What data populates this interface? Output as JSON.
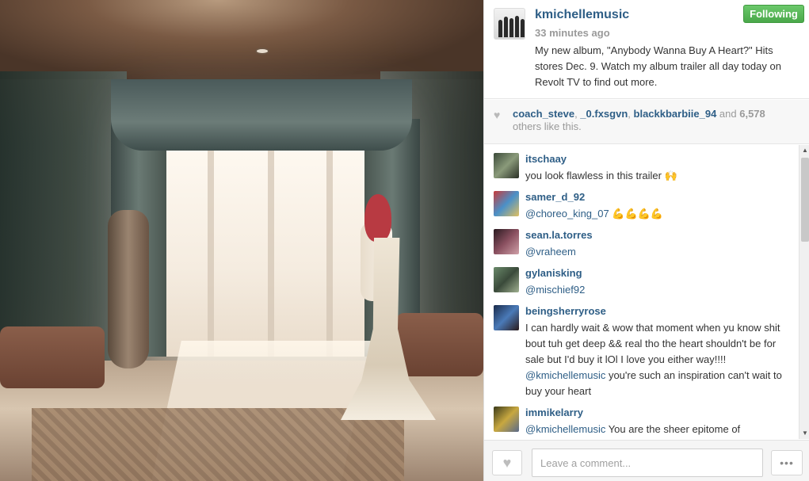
{
  "post": {
    "username": "kmichellemusic",
    "time": "33 minutes ago",
    "caption": "My new album, \"Anybody Wanna Buy A Heart?\" Hits stores Dec. 9. Watch my album trailer all day today on Revolt TV to find out more.",
    "follow_label": "Following"
  },
  "likes": {
    "user1": "coach_steve",
    "sep1": ", ",
    "user2": "_0.fxsgvn",
    "sep2": ", ",
    "user3": "blackkbarbiie_94",
    "and": " and ",
    "count": "6,578",
    "tail": "others like this."
  },
  "comments": [
    {
      "user": "itschaay",
      "text": "you look flawless in this trailer 🙌"
    },
    {
      "user": "samer_d_92",
      "mention": "@choreo_king_07",
      "text": " 💪💪💪💪"
    },
    {
      "user": "sean.la.torres",
      "mention": "@vraheem",
      "text": ""
    },
    {
      "user": "gylanisking",
      "mention": "@mischief92",
      "text": ""
    },
    {
      "user": "beingsherryrose",
      "text": "I can hardly wait & wow that moment when yu know shit bout tuh get deep && real tho the heart shouldn't be for sale but I'd buy it lOl I love you either way!!!! ",
      "mention": "@kmichellemusic",
      "text2": " you're such an inspiration can't wait to buy your heart"
    },
    {
      "user": "immikelarry",
      "mention": "@kmichellemusic",
      "text": " You are the sheer epitome of"
    }
  ],
  "footer": {
    "comment_placeholder": "Leave a comment...",
    "more_label": "•••"
  },
  "icons": {
    "heart": "♥",
    "scroll_up": "▲",
    "scroll_down": "▼"
  },
  "colors": {
    "link": "#2e5e86",
    "follow": "#4aa84a"
  }
}
